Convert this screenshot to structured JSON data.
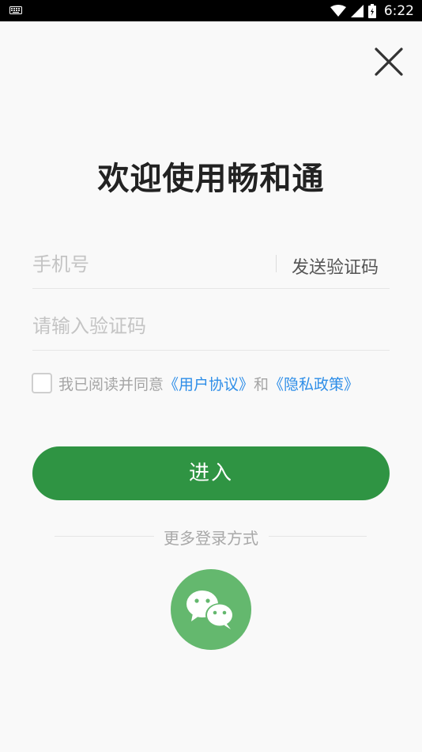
{
  "status_bar": {
    "time": "6:22"
  },
  "header": {
    "title": "欢迎使用畅和通"
  },
  "form": {
    "phone_placeholder": "手机号",
    "send_code_label": "发送验证码",
    "code_placeholder": "请输入验证码"
  },
  "agreement": {
    "prefix": "我已阅读并同意",
    "user_agreement": "《用户协议》",
    "conjunction": "和",
    "privacy_policy": "《隐私政策》"
  },
  "enter_button": {
    "label": "进入"
  },
  "more_login": {
    "label": "更多登录方式"
  },
  "colors": {
    "primary_green": "#2f9443",
    "wechat_green": "#64b86e",
    "link_blue": "#2e8ee8"
  },
  "icons": {
    "close": "close-icon",
    "wechat": "wechat-icon",
    "wifi": "wifi-icon",
    "signal": "signal-icon",
    "battery": "battery-icon",
    "keyboard": "keyboard-icon"
  }
}
